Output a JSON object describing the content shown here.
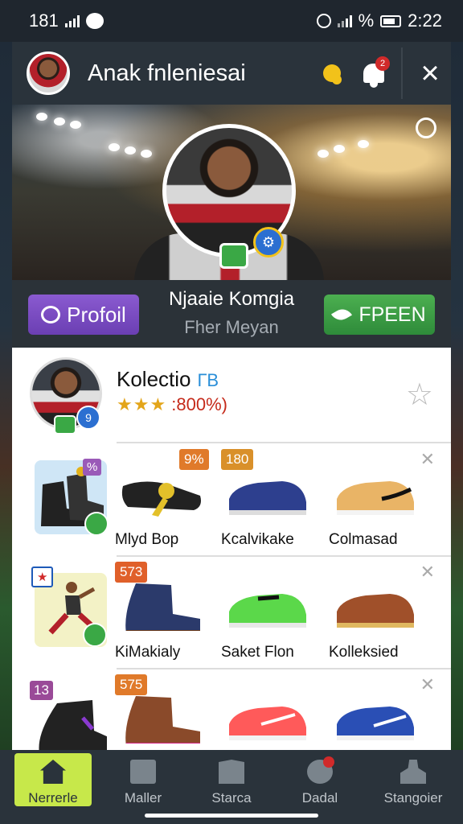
{
  "status_bar": {
    "left_text": "181",
    "battery_pct": "%",
    "time": "2:22"
  },
  "header": {
    "title": "Anak fnleniesai",
    "notification_count": "2"
  },
  "banner": {
    "verified_icon": "settings-icon"
  },
  "profile_row": {
    "profile_button": "Profoil",
    "name": "Njaaie Komgia",
    "subtitle": "Fher Meyan",
    "free_button": "FPEEN"
  },
  "collection": {
    "title": "Kolectio",
    "title_badge": "ГВ",
    "stars": "★★★",
    "rating_text": ":800%)"
  },
  "rows": [
    {
      "thumb_badge": "%",
      "products": [
        {
          "badge": "9%",
          "label": "Mlyd Bop",
          "color": "#222222"
        },
        {
          "badge": "180",
          "label": "Kcalvikake",
          "color": "#2d3f8e"
        },
        {
          "badge": "",
          "label": "Colmasad",
          "color": "#e9b466"
        }
      ]
    },
    {
      "thumb_badge": "★",
      "products": [
        {
          "badge": "573",
          "label": "KiMakialy",
          "color": "#2b3a6b"
        },
        {
          "badge": "",
          "label": "Saket Flon",
          "color": "#5bd84a"
        },
        {
          "badge": "",
          "label": "Kolleksied",
          "color": "#a0502a"
        }
      ]
    },
    {
      "thumb_badge": "13",
      "products": [
        {
          "badge": "575",
          "label": "",
          "color": "#8a4a2a"
        },
        {
          "badge": "",
          "label": "",
          "color": "#ff5a5a"
        },
        {
          "badge": "",
          "label": "",
          "color": "#2a4fb5"
        }
      ]
    }
  ],
  "nav": [
    {
      "label": "Nerrerle",
      "icon": "home-icon"
    },
    {
      "label": "Maller",
      "icon": "mail-icon"
    },
    {
      "label": "Starca",
      "icon": "book-icon"
    },
    {
      "label": "Dadal",
      "icon": "ball-icon"
    },
    {
      "label": "Stangoier",
      "icon": "person-icon"
    }
  ]
}
